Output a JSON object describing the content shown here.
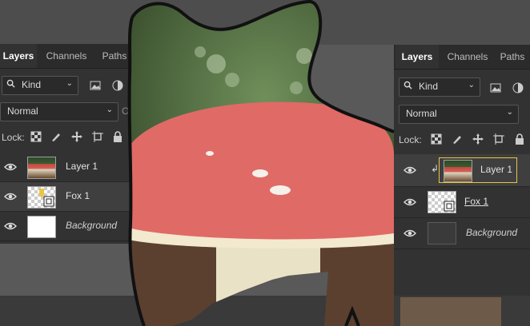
{
  "left_panel": {
    "tabs": [
      "Layers",
      "Channels",
      "Paths"
    ],
    "kind_label": "Kind",
    "blend_mode": "Normal",
    "opacity_label": "Opa",
    "lock_label": "Lock:",
    "layers": [
      {
        "name": "Layer 1",
        "thumb": "photo",
        "selected": false
      },
      {
        "name": "Fox 1",
        "thumb": "checker",
        "selected": true
      },
      {
        "name": "Background",
        "thumb": "white",
        "selected": false
      }
    ]
  },
  "right_panel": {
    "tabs": [
      "Layers",
      "Channels",
      "Paths"
    ],
    "kind_label": "Kind",
    "blend_mode": "Normal",
    "lock_label": "Lock:",
    "layers": [
      {
        "name": "Layer 1",
        "thumb": "photo",
        "selected": true
      },
      {
        "name": "Fox 1",
        "thumb": "checker",
        "selected": false
      },
      {
        "name": "Background",
        "thumb": "dark",
        "selected": false
      }
    ]
  },
  "colors": {
    "panel_bg": "#323232",
    "tab_bg": "#2b2b2b",
    "mushroom_cap": "#e06a66",
    "selection_highlight": "#e8c547",
    "outline": "#111111"
  }
}
